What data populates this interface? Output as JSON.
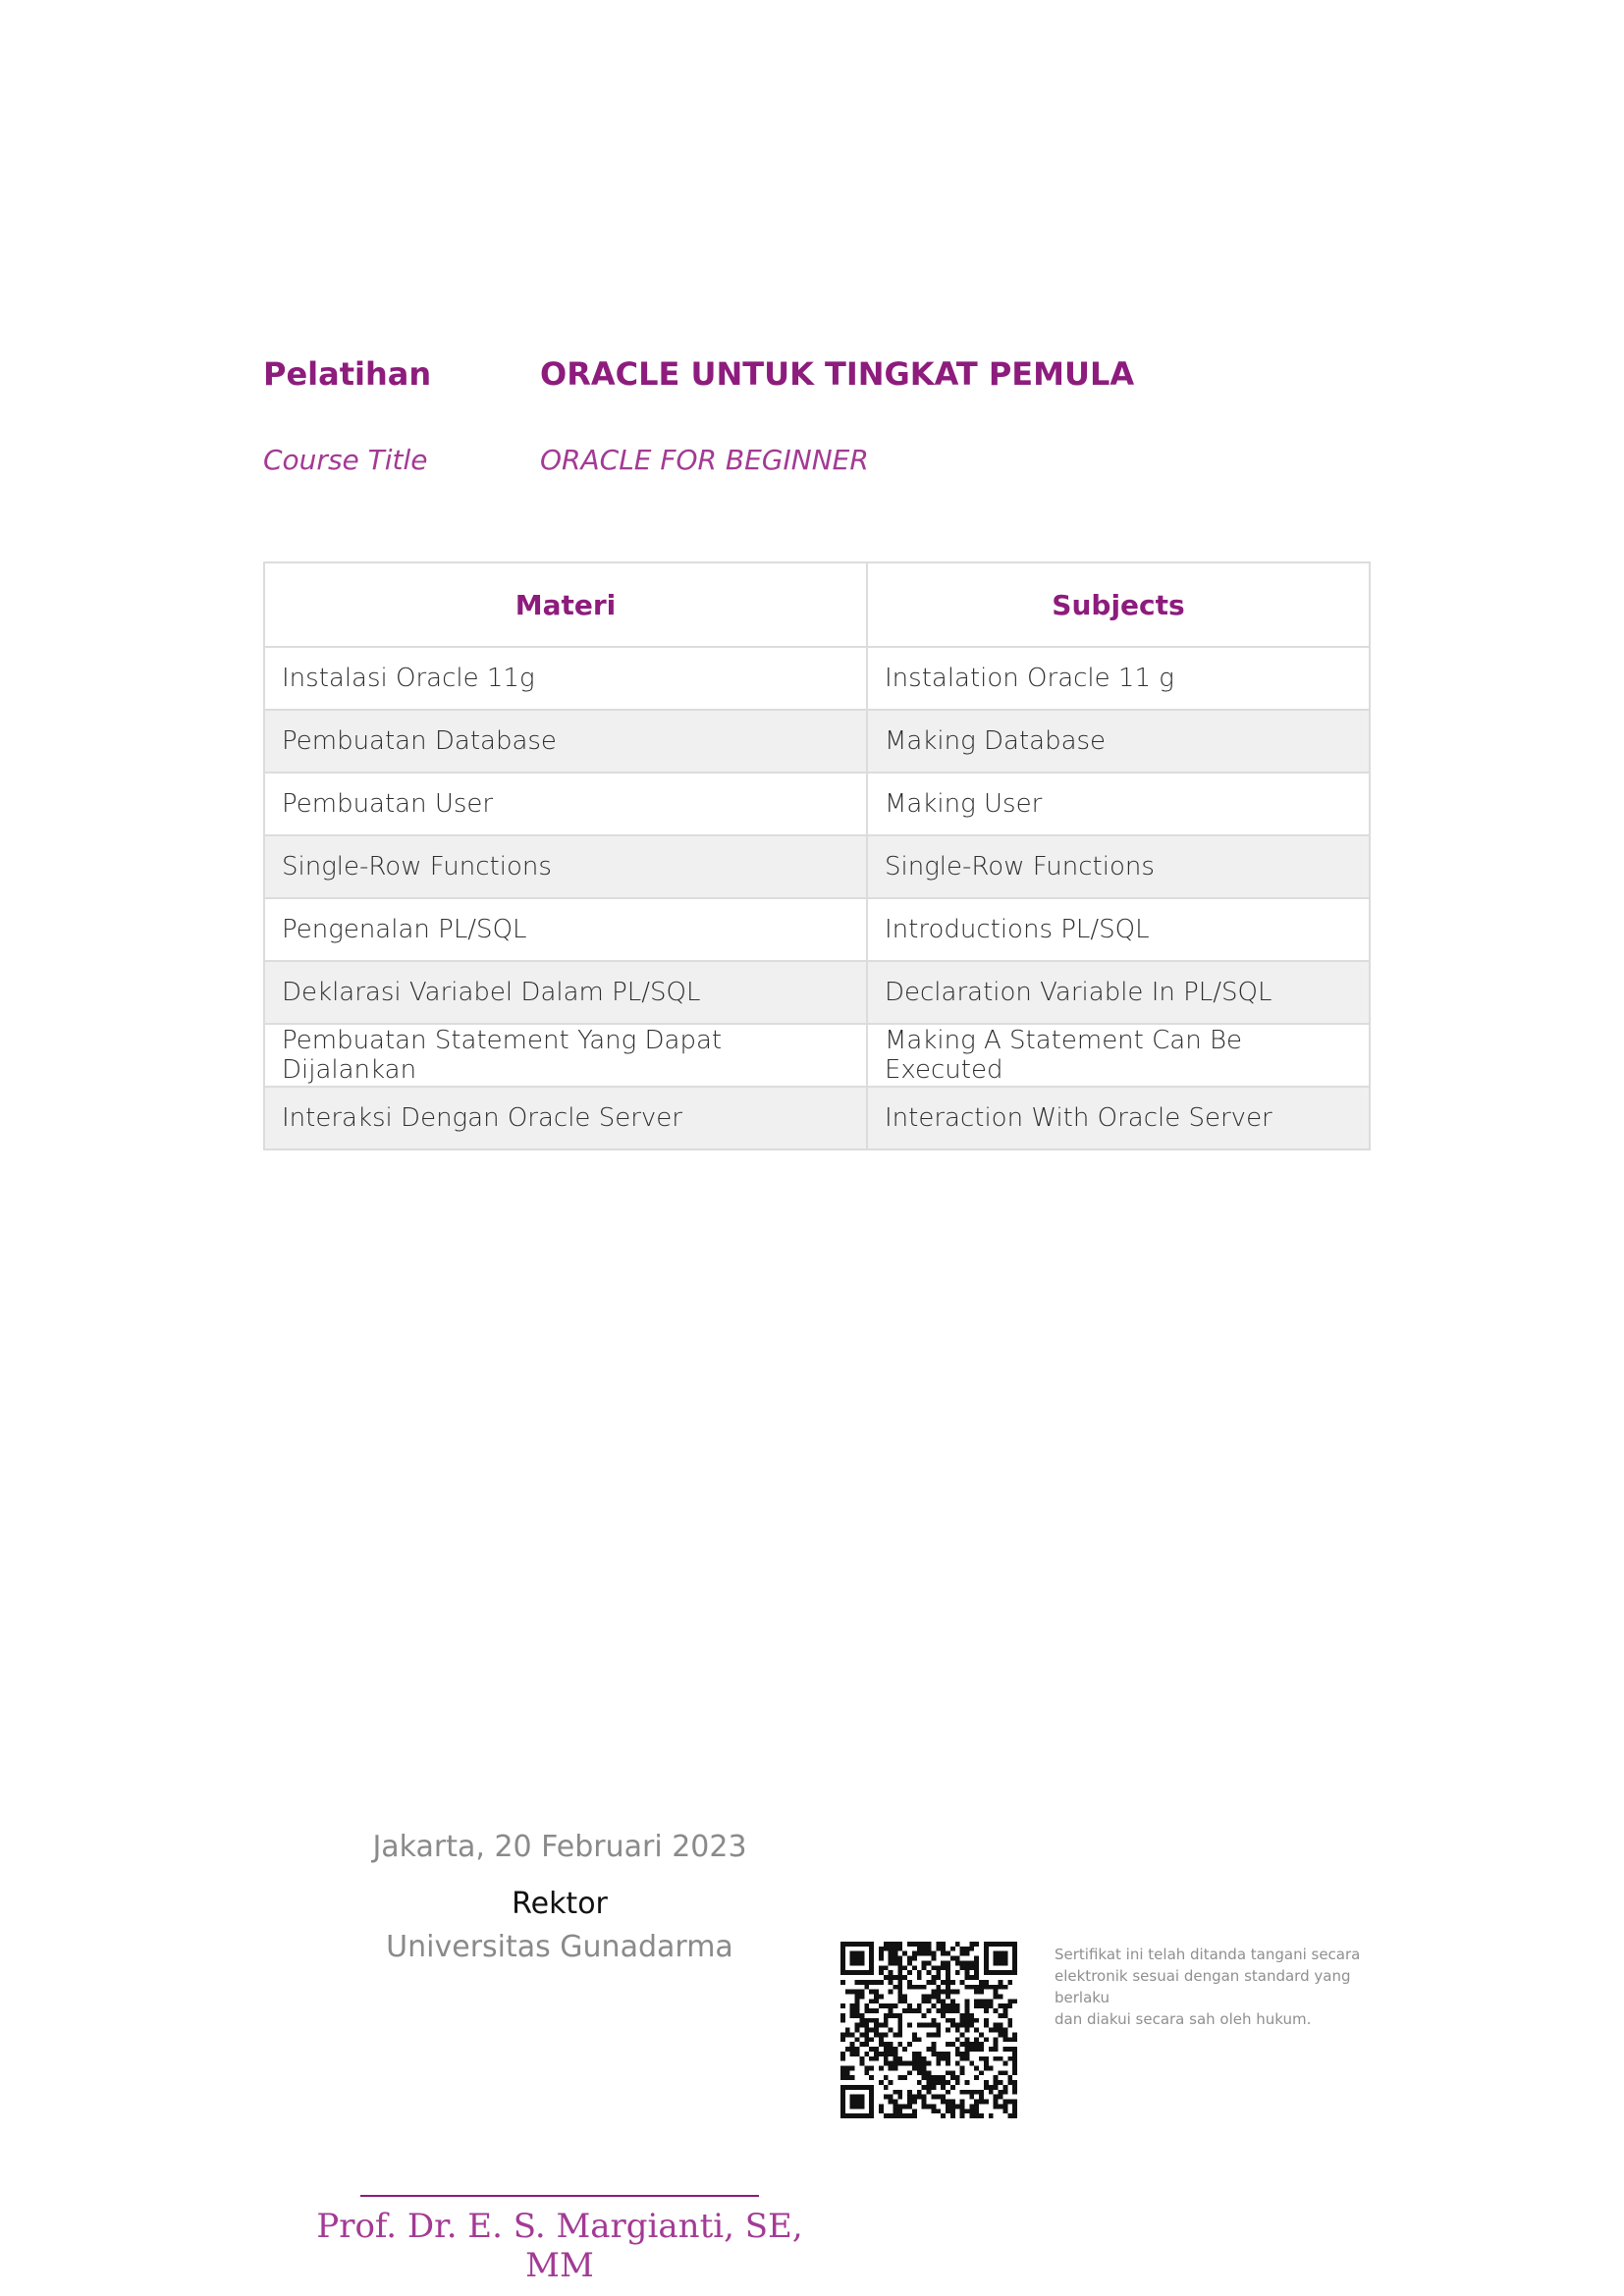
{
  "course": {
    "label_id": "Pelatihan",
    "title_id": "ORACLE UNTUK TINGKAT PEMULA",
    "label_en": "Course Title",
    "title_en": "ORACLE FOR BEGINNER"
  },
  "subjects_table": {
    "headers": [
      "Materi",
      "Subjects"
    ],
    "rows": [
      [
        "Instalasi Oracle 11g",
        "Instalation Oracle 11 g"
      ],
      [
        "Pembuatan Database",
        "Making Database"
      ],
      [
        "Pembuatan User",
        "Making User"
      ],
      [
        "Single-Row Functions",
        "Single-Row Functions"
      ],
      [
        "Pengenalan PL/SQL",
        "Introductions PL/SQL"
      ],
      [
        "Deklarasi Variabel Dalam PL/SQL",
        "Declaration Variable In PL/SQL"
      ],
      [
        "Pembuatan Statement Yang Dapat Dijalankan",
        "Making A Statement Can Be Executed"
      ],
      [
        "Interaksi Dengan Oracle Server",
        "Interaction With Oracle Server"
      ]
    ]
  },
  "signature": {
    "place_date": "Jakarta, 20 Februari 2023",
    "role": "Rektor",
    "institution": "Universitas Gunadarma",
    "name": "Prof. Dr. E. S. Margianti, SE, MM"
  },
  "esign_note": {
    "line1": "Sertifikat ini telah ditanda tangani secara",
    "line2": "elektronik sesuai dengan standard yang",
    "line3": "berlaku",
    "line4": "dan diakui secara sah oleh hukum."
  },
  "colors": {
    "accent": "#8d1c7d",
    "accent_light": "#a33a94",
    "muted_text": "#8a8a8a",
    "row_stripe": "#f0f0f0"
  },
  "icons": {
    "qr": "qr-code-icon"
  }
}
